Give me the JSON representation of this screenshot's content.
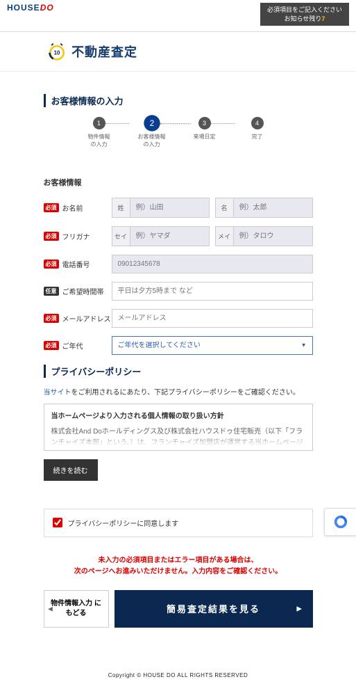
{
  "header": {
    "logo_house": "HOUSE",
    "logo_do": "DO",
    "notice_line1": "必須項目をご記入ください",
    "notice_line2_pre": "お知らせ残り",
    "notice_count": "7"
  },
  "title": {
    "badge_top": "10",
    "text": "不動産査定"
  },
  "sections": {
    "input_h": "お客様情報の入力",
    "info_h": "お客様情報",
    "policy_h": "プライバシーポリシー"
  },
  "steps": [
    {
      "num": "1",
      "label": "物件情報\nの入力"
    },
    {
      "num": "2",
      "label": "お客様情報\nの入力"
    },
    {
      "num": "3",
      "label": "来場日定"
    },
    {
      "num": "4",
      "label": "完了"
    }
  ],
  "badges": {
    "required": "必須",
    "optional": "任意"
  },
  "fields": {
    "name": {
      "label": "お名前",
      "sei": "姓",
      "mei": "名",
      "sei_ph": "例）山田",
      "mei_ph": "例）太郎"
    },
    "kana": {
      "label": "フリガナ",
      "sei": "セイ",
      "mei": "メイ",
      "sei_ph": "例）ヤマダ",
      "mei_ph": "例）タロウ"
    },
    "phone": {
      "label": "電話番号",
      "ph": "09012345678"
    },
    "time": {
      "label": "ご希望時間帯",
      "ph": "平日は夕方5時まで など"
    },
    "email": {
      "label": "メールアドレス",
      "ph": "メールアドレス"
    },
    "age": {
      "label": "ご年代",
      "ph": "ご年代を選択してください"
    }
  },
  "policy": {
    "desc_pre": "当サイト",
    "desc_post": "をご利用されるにあたり、下記プライバシーポリシーをご確認ください。",
    "box_h": "当ホームページより入力される個人情報の取り扱い方針",
    "box_body": "株式会社And Doホールディングス及び株式会社ハウスドゥ住宅販売（以下「フランチャイズ本部」という。）は、フランチャイズ加盟店が運営する当ホームページより入力される個人情報の取り扱いについて、以下のとおりプライバシーポリシーを定めます。",
    "read_more": "続きを読む"
  },
  "agree": {
    "label": "プライバシーポリシーに同意します"
  },
  "error": {
    "line1": "未入力の必須項目またはエラー項目がある場合は、",
    "line2": "次のページへお進みいただけません。入力内容をご確認ください。"
  },
  "buttons": {
    "back": "物件情報入力\nにもどる",
    "submit": "簡易査定結果を見る"
  },
  "footer": {
    "copyright": "Copyright © HOUSE DO ALL RIGHTS RESERVED"
  }
}
